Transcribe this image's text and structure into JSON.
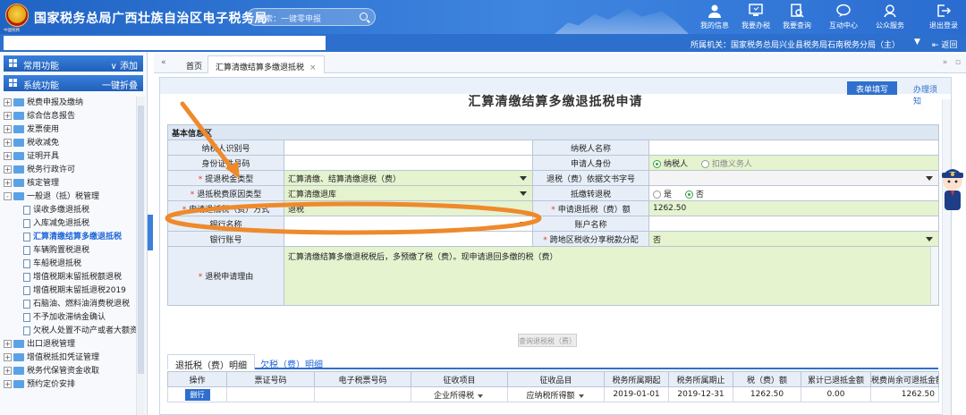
{
  "header": {
    "emblem_text": "中國稅務",
    "title": "国家税务总局广西壮族自治区电子税务局",
    "search_placeholder": "搜索：一键零申报",
    "nav": [
      {
        "label": "我的信息",
        "icon": "user-icon"
      },
      {
        "label": "我要办税",
        "icon": "computer-icon"
      },
      {
        "label": "我要查询",
        "icon": "document-search-icon"
      },
      {
        "label": "互动中心",
        "icon": "chat-icon"
      },
      {
        "label": "公众服务",
        "icon": "service-icon"
      },
      {
        "label": "退出登录",
        "icon": "logout-icon"
      }
    ]
  },
  "subbar": {
    "org_label": "所属机关：",
    "org_value": "国家税务总局兴业县税务局石南税务分局（主）",
    "back_label": "返回"
  },
  "sidebar": {
    "common": {
      "label": "常用功能",
      "action": "添加"
    },
    "system": {
      "label": "系统功能",
      "action": "一键折叠"
    },
    "tree": [
      {
        "label": "税费申报及缴纳",
        "type": "folder",
        "level": 0,
        "state": "+"
      },
      {
        "label": "综合信息报告",
        "type": "folder",
        "level": 0,
        "state": "+"
      },
      {
        "label": "发票使用",
        "type": "folder",
        "level": 0,
        "state": "+"
      },
      {
        "label": "税收减免",
        "type": "folder",
        "level": 0,
        "state": "+"
      },
      {
        "label": "证明开具",
        "type": "folder",
        "level": 0,
        "state": "+"
      },
      {
        "label": "税务行政许可",
        "type": "folder",
        "level": 0,
        "state": "+"
      },
      {
        "label": "核定管理",
        "type": "folder",
        "level": 0,
        "state": "+"
      },
      {
        "label": "一般退（抵）税管理",
        "type": "folder",
        "level": 0,
        "state": "-"
      },
      {
        "label": "误收多缴退抵税",
        "type": "doc",
        "level": 1
      },
      {
        "label": "入库减免退抵税",
        "type": "doc",
        "level": 1
      },
      {
        "label": "汇算清缴结算多缴退抵税",
        "type": "doc",
        "level": 1,
        "active": true
      },
      {
        "label": "车辆购置税退税",
        "type": "doc",
        "level": 1
      },
      {
        "label": "车船税退抵税",
        "type": "doc",
        "level": 1
      },
      {
        "label": "增值税期末留抵税额退税",
        "type": "doc",
        "level": 1
      },
      {
        "label": "增值税期末留抵退税2019",
        "type": "doc",
        "level": 1
      },
      {
        "label": "石脑油、燃料油消费税退税",
        "type": "doc",
        "level": 1
      },
      {
        "label": "不予加收滞纳金确认",
        "type": "doc",
        "level": 1
      },
      {
        "label": "欠税人处置不动产或者大额资产报告",
        "type": "doc",
        "level": 1
      },
      {
        "label": "出口退税管理",
        "type": "folder",
        "level": 0,
        "state": "+"
      },
      {
        "label": "增值税抵扣凭证管理",
        "type": "folder",
        "level": 0,
        "state": "+"
      },
      {
        "label": "税务代保管资金收取",
        "type": "folder",
        "level": 0,
        "state": "+"
      },
      {
        "label": "预约定价安排",
        "type": "folder",
        "level": 0,
        "state": "+"
      }
    ]
  },
  "tabs": {
    "home": "首页",
    "current": "汇算清缴结算多缴退抵税",
    "close": "×",
    "nav_left": "«",
    "nav_right": "»"
  },
  "content": {
    "fill_tab": "表单填写",
    "guide_tab": "办理须知",
    "form_title": "汇算清缴结算多缴退抵税申请",
    "section_basic": "基本信息区",
    "fields": {
      "taxpayer_id_label": "纳税人识别号",
      "taxpayer_id_value": "",
      "taxpayer_name_label": "纳税人名称",
      "taxpayer_name_value": "",
      "id_doc_label": "身份证件号码",
      "id_doc_value": "",
      "applicant_identity_label": "申请人身份",
      "applicant_identity_options": [
        "纳税人",
        "扣缴义务人"
      ],
      "applicant_identity_selected": "纳税人",
      "refund_type_label": "提退税金类型",
      "refund_type_value": "汇算清缴、结算清缴退税（费）",
      "basis_doc_label": "退税（费）依据文书字号",
      "basis_doc_value": "",
      "source_type_label": "退抵税费原因类型",
      "source_type_value": "汇算清缴退库",
      "offset_label": "抵缴转退税",
      "offset_options": [
        "是",
        "否"
      ],
      "offset_selected": "否",
      "method_label": "申请退抵税（费）方式",
      "method_value": "退税",
      "amount_label": "申请退抵税（费）额",
      "amount_value": "1262.50",
      "bank_name_label": "银行名称",
      "bank_name_value": "",
      "account_name_label": "账户名称",
      "account_name_value": "",
      "bank_account_label": "银行账号",
      "bank_account_value": "",
      "cross_region_label": "跨地区税收分享税款分配",
      "cross_region_value": "否",
      "reason_label": "退税申请理由",
      "reason_value": "汇算清缴结算多缴退税税后，多预缴了税（费）。现申请退回多缴的税（费）"
    },
    "query_button": "查询退税税（费）",
    "detail_tabs": [
      "退抵税（费）明细",
      "欠税（费）明细"
    ],
    "detail_table": {
      "columns": [
        "操作",
        "票证号码",
        "电子税票号码",
        "征收项目",
        "征收品目",
        "税务所属期起",
        "税务所属期止",
        "税（费）额",
        "累计已退抵金额",
        "税费尚余可退抵金额"
      ],
      "rows": [
        {
          "action": "删行",
          "voucher": "",
          "e_voucher": "",
          "item": "企业所得税",
          "sub_item": "应纳税所得额",
          "start": "2019-01-01",
          "end": "2019-12-31",
          "amount": "1262.50",
          "refunded": "0.00",
          "remaining": "1262.50"
        }
      ]
    }
  },
  "colors": {
    "header_blue": "#1f63c4",
    "highlight_orange": "#ee8a2c",
    "field_green": "#e5f3cf",
    "active_link": "#1f66d6"
  }
}
